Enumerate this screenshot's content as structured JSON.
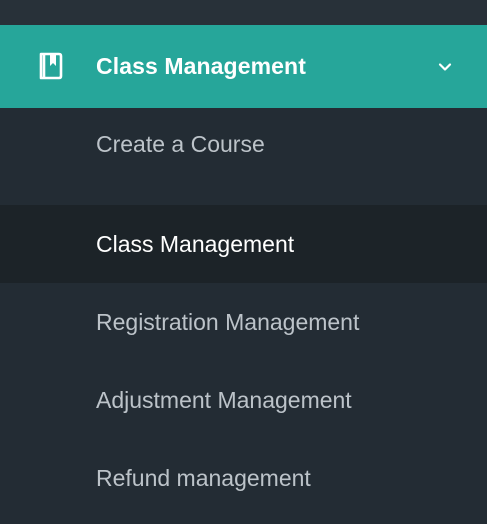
{
  "menu": {
    "header_label": "Class Management",
    "header_icon": "book-bookmark-icon",
    "expand_icon": "chevron-down-icon",
    "accent_color": "#26a69a",
    "expanded": true
  },
  "submenu": {
    "items": [
      {
        "label": "Create a Course",
        "active": false
      },
      {
        "label": "Class Management",
        "active": true
      },
      {
        "label": "Registration Management",
        "active": false
      },
      {
        "label": "Adjustment Management",
        "active": false
      },
      {
        "label": "Refund management",
        "active": false
      }
    ]
  }
}
